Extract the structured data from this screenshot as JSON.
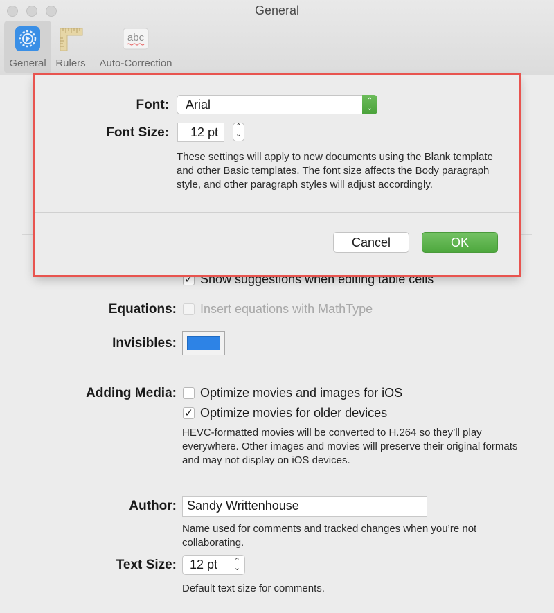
{
  "window": {
    "title": "General"
  },
  "toolbar": {
    "items": [
      {
        "label": "General",
        "icon": "gear-icon"
      },
      {
        "label": "Rulers",
        "icon": "ruler-icon"
      },
      {
        "label": "Auto-Correction",
        "icon": "abc-icon"
      }
    ],
    "abc_glyph": "abc"
  },
  "sheet": {
    "font_label": "Font:",
    "font_value": "Arial",
    "font_size_label": "Font Size:",
    "font_size_value": "12 pt",
    "description": "These settings will apply to new documents using the Blank template and other Basic templates. The font size affects the Body paragraph style, and other paragraph styles will adjust accordingly.",
    "cancel_label": "Cancel",
    "ok_label": "OK"
  },
  "prefs": {
    "show_suggestions": {
      "label": "Show suggestions when editing table cells",
      "checked": true
    },
    "equations": {
      "label": "Equations:",
      "option": "Insert equations with MathType",
      "checked": false
    },
    "invisibles": {
      "label": "Invisibles:",
      "color": "#2d83e6"
    },
    "adding_media": {
      "label": "Adding Media:",
      "option1": "Optimize movies and images for iOS",
      "option2": "Optimize movies for older devices",
      "note": "HEVC-formatted movies will be converted to H.264 so they’ll play everywhere. Other images and movies will preserve their original formats and may not display on iOS devices."
    },
    "author": {
      "label": "Author:",
      "value": "Sandy Writtenhouse",
      "note": "Name used for comments and tracked changes when you’re not collaborating."
    },
    "text_size": {
      "label": "Text Size:",
      "value": "12 pt",
      "note": "Default text size for comments."
    }
  },
  "glyphs": {
    "check": "✓",
    "updown": "⌃⌄"
  }
}
